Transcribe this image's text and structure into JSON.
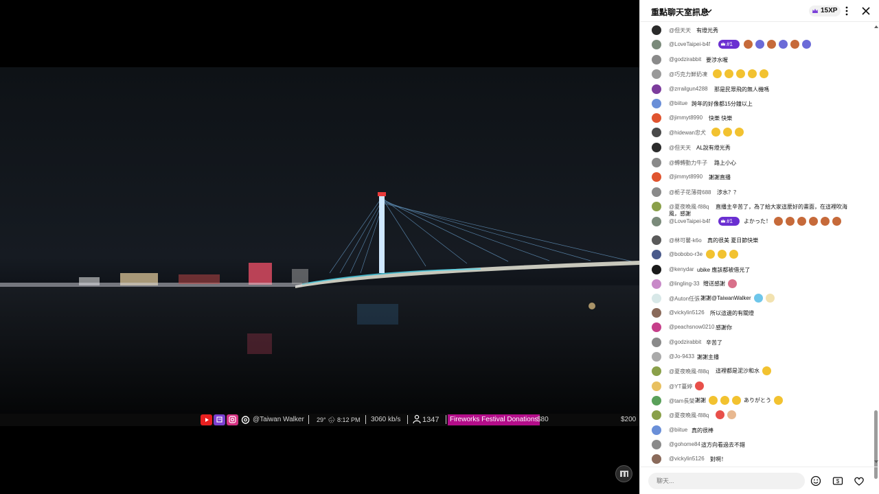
{
  "overlay": {
    "channel": "@Taiwan Walker",
    "weather": "29° 🌧 8:12 PM",
    "bitrate": "3060 kb/s",
    "viewers": "1347",
    "donation_label": "Fireworks Festival Donations",
    "donation_amount": "$80",
    "donation_goal": "$200"
  },
  "chat": {
    "title": "重點聊天室訊息",
    "xp": "15XP",
    "input_placeholder": "聊天...",
    "messages": [
      {
        "author": "@但天天",
        "text": "有燈光秀",
        "avatar_color": "#2b2b2b"
      },
      {
        "author": "@LoveTaipei-b4f",
        "rank": "#1",
        "text": "",
        "emojis": [
          "#c66a3a",
          "#6b6bd8",
          "#c66a3a",
          "#6b6bd8",
          "#c66a3a",
          "#6b6bd8"
        ],
        "avatar_color": "#7a8a7a"
      },
      {
        "author": "@godzirabbit",
        "text": "要涉水喔",
        "avatar_color": "#8a8a8a"
      },
      {
        "author": "@巧克力鮮奶凍",
        "text": "",
        "emojis": [
          "#f2c230",
          "#f2c230",
          "#f2c230",
          "#f2c230",
          "#f2c230"
        ],
        "avatar_color": "#9a9a9a"
      },
      {
        "author": "@zrrailgun4288",
        "text": "那是民眾飛的無人機嗎",
        "avatar_color": "#7c3c9c"
      },
      {
        "author": "@biitue",
        "text": "跨年的好像都15分鐘以上",
        "avatar_color": "#6a8fd8"
      },
      {
        "author": "@jimmyt8990",
        "text": "快樂 快樂",
        "avatar_color": "#e0542f"
      },
      {
        "author": "@hidewan忠犬",
        "text": "",
        "emojis": [
          "#f2c230",
          "#f2c230",
          "#f2c230"
        ],
        "avatar_color": "#4a4a4a"
      },
      {
        "author": "@但天天",
        "text": "AL說有燈光秀",
        "avatar_color": "#2b2b2b"
      },
      {
        "author": "@轉轉動力牛子",
        "text": "路上小心",
        "avatar_color": "#8a8a8a"
      },
      {
        "author": "@jimmyt8990",
        "text": "謝謝直播",
        "avatar_color": "#e0542f"
      },
      {
        "author": "@栀子花薄荷688",
        "text": "涉水？？",
        "avatar_color": "#8a8a8a"
      },
      {
        "author": "@夏夜晚風-f88q",
        "text": "直播主辛苦了，為了給大家這麼好的畫面，在這裡吹海",
        "text2": "風，感謝",
        "avatar_color": "#8aa04a"
      },
      {
        "author": "@LoveTaipei-b4f",
        "rank": "#1",
        "text": "よかった！",
        "emojis": [
          "#c66a3a",
          "#c66a3a",
          "#c66a3a",
          "#c66a3a",
          "#c66a3a",
          "#c66a3a"
        ],
        "avatar_color": "#7a8a7a"
      },
      {
        "author": "@林可馨-k6o",
        "text": "真的很美 夏日節快樂",
        "avatar_color": "#5a5a5a"
      },
      {
        "author": "@bobobo-r3e",
        "text": "",
        "emojis": [
          "#f2c230",
          "#f2c230",
          "#f2c230"
        ],
        "avatar_color": "#4a5a8a"
      },
      {
        "author": "@kenydar",
        "text": "ubike 應該都被借光了",
        "avatar_color": "#1a1a1a"
      },
      {
        "author": "@lingling-33",
        "text": "贈送感謝",
        "emojis": [
          "#d8708a"
        ],
        "avatar_color": "#c88ac8"
      },
      {
        "author": "@Auton任張",
        "text": "謝謝@TaiwanWalker",
        "emojis": [
          "#6ec6ea",
          "#f2e2b0"
        ],
        "avatar_color": "#d8e8e8"
      },
      {
        "author": "@vickylin5126",
        "text": "所以這邊的有關燈",
        "avatar_color": "#8a6a5a"
      },
      {
        "author": "@peachsnow0210",
        "text": "感謝你",
        "avatar_color": "#c63f8a"
      },
      {
        "author": "@godzirabbit",
        "text": "辛苦了",
        "avatar_color": "#8a8a8a"
      },
      {
        "author": "@Jo-9433",
        "text": "謝謝主播",
        "avatar_color": "#aaaaaa"
      },
      {
        "author": "@夏夜晚風-f88q",
        "text": "這裡都是泥沙和水",
        "emojis": [
          "#f2c230"
        ],
        "avatar_color": "#8aa04a"
      },
      {
        "author": "@YT蔓婷",
        "text": "",
        "emojis": [
          "#e8504a"
        ],
        "avatar_color": "#e8c060"
      },
      {
        "author": "@tam長榮",
        "text": "謝謝",
        "text_after": "ありがとう",
        "emojis": [
          "#f2c230",
          "#f2c230",
          "#f2c230"
        ],
        "emojis_after": [
          "#f2c230"
        ],
        "avatar_color": "#5aa05a"
      },
      {
        "author": "@夏夜晚風-f88q",
        "text": "",
        "emojis": [
          "#e8504a",
          "#e8b890"
        ],
        "avatar_color": "#8aa04a"
      },
      {
        "author": "@biitue",
        "text": "真的很棒",
        "avatar_color": "#6a8fd8"
      },
      {
        "author": "@gohome84",
        "text": "這方向看過去不錯",
        "avatar_color": "#8a8a8a"
      },
      {
        "author": "@vickylin5126",
        "text": "對啊！",
        "avatar_color": "#8a6a5a"
      }
    ]
  }
}
